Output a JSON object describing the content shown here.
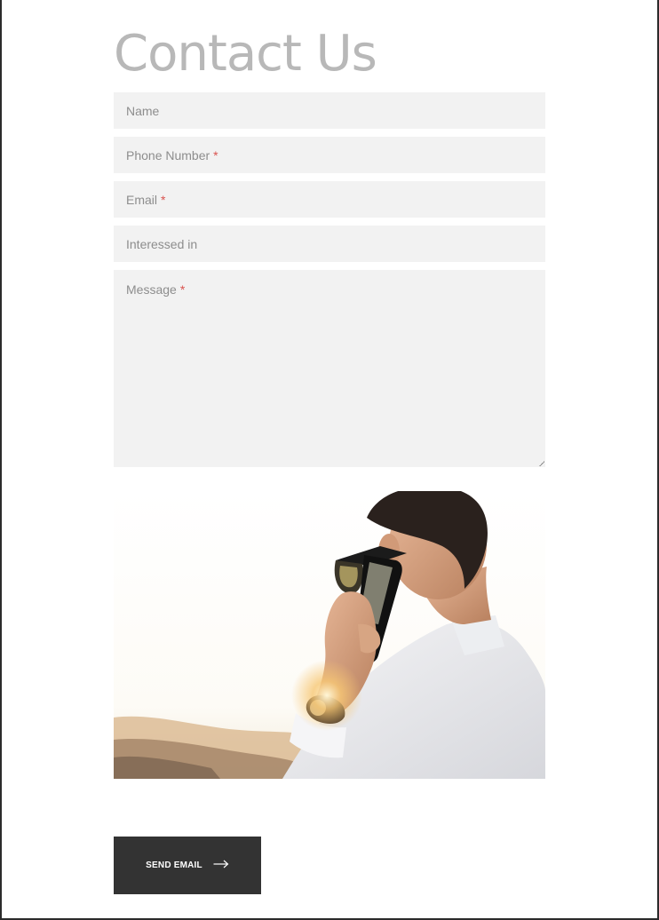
{
  "page": {
    "title": "Contact Us"
  },
  "form": {
    "fields": [
      {
        "placeholder": "Name",
        "required_mark": ""
      },
      {
        "placeholder": "Phone Number",
        "required_mark": "*"
      },
      {
        "placeholder": "Email",
        "required_mark": "*"
      },
      {
        "placeholder": "Interessed in",
        "required_mark": ""
      },
      {
        "placeholder": "Message",
        "required_mark": "*"
      }
    ],
    "submit_label": "SEND EMAIL",
    "submit_icon": "arrow-right-icon"
  },
  "image": {
    "subject": "man-talking-on-phone-photo"
  },
  "colors": {
    "field_bg": "#f2f2f2",
    "required": "#d9534f",
    "button_bg": "#333333",
    "title": "#b8b8b8"
  }
}
